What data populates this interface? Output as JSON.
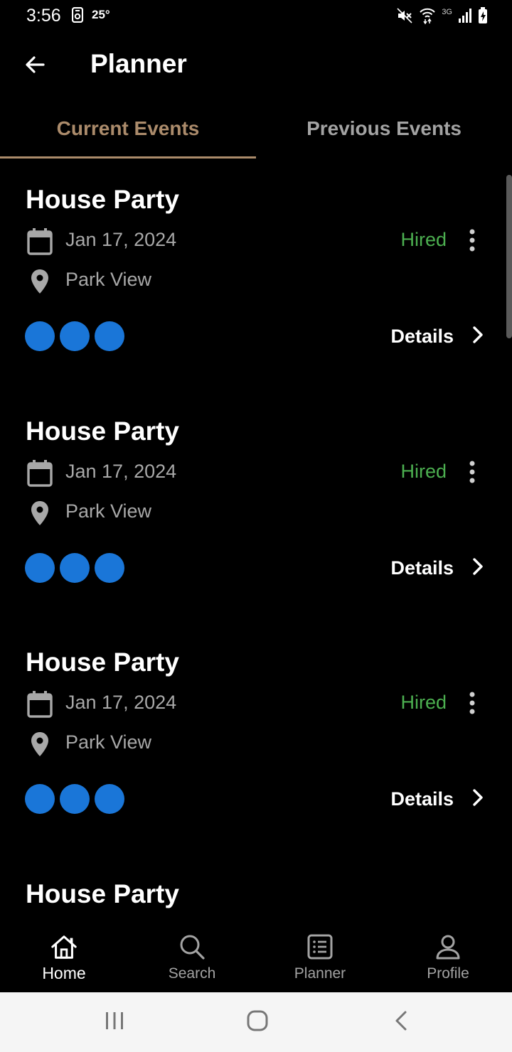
{
  "status_bar": {
    "time": "3:56",
    "temperature": "25°",
    "network_type": "3G",
    "icons": [
      "storage-icon",
      "mute-icon",
      "wifi-icon",
      "signal-icon",
      "battery-charging-icon"
    ]
  },
  "header": {
    "title": "Planner",
    "back_icon": "arrow-left-icon"
  },
  "tabs": [
    {
      "label": "Current Events",
      "active": true
    },
    {
      "label": "Previous Events",
      "active": false
    }
  ],
  "events": [
    {
      "title": "House Party",
      "date": "Jan 17, 2024",
      "location": "Park View",
      "status": "Hired",
      "details_label": "Details",
      "avatar_count": 3
    },
    {
      "title": "House Party",
      "date": "Jan 17, 2024",
      "location": "Park View",
      "status": "Hired",
      "details_label": "Details",
      "avatar_count": 3
    },
    {
      "title": "House Party",
      "date": "Jan 17, 2024",
      "location": "Park View",
      "status": "Hired",
      "details_label": "Details",
      "avatar_count": 3
    },
    {
      "title": "House Party",
      "date": "",
      "location": "",
      "status": "",
      "details_label": "",
      "avatar_count": 0
    }
  ],
  "bottom_nav": [
    {
      "label": "Home",
      "icon": "home-icon",
      "active": true
    },
    {
      "label": "Search",
      "icon": "search-icon",
      "active": false
    },
    {
      "label": "Planner",
      "icon": "planner-icon",
      "active": false
    },
    {
      "label": "Profile",
      "icon": "profile-icon",
      "active": false
    }
  ],
  "colors": {
    "accent": "#ab8b6b",
    "status_hired": "#4caf50",
    "avatar_blue": "#1a76d8",
    "background": "#000000",
    "muted_text": "#a8a8a8"
  }
}
